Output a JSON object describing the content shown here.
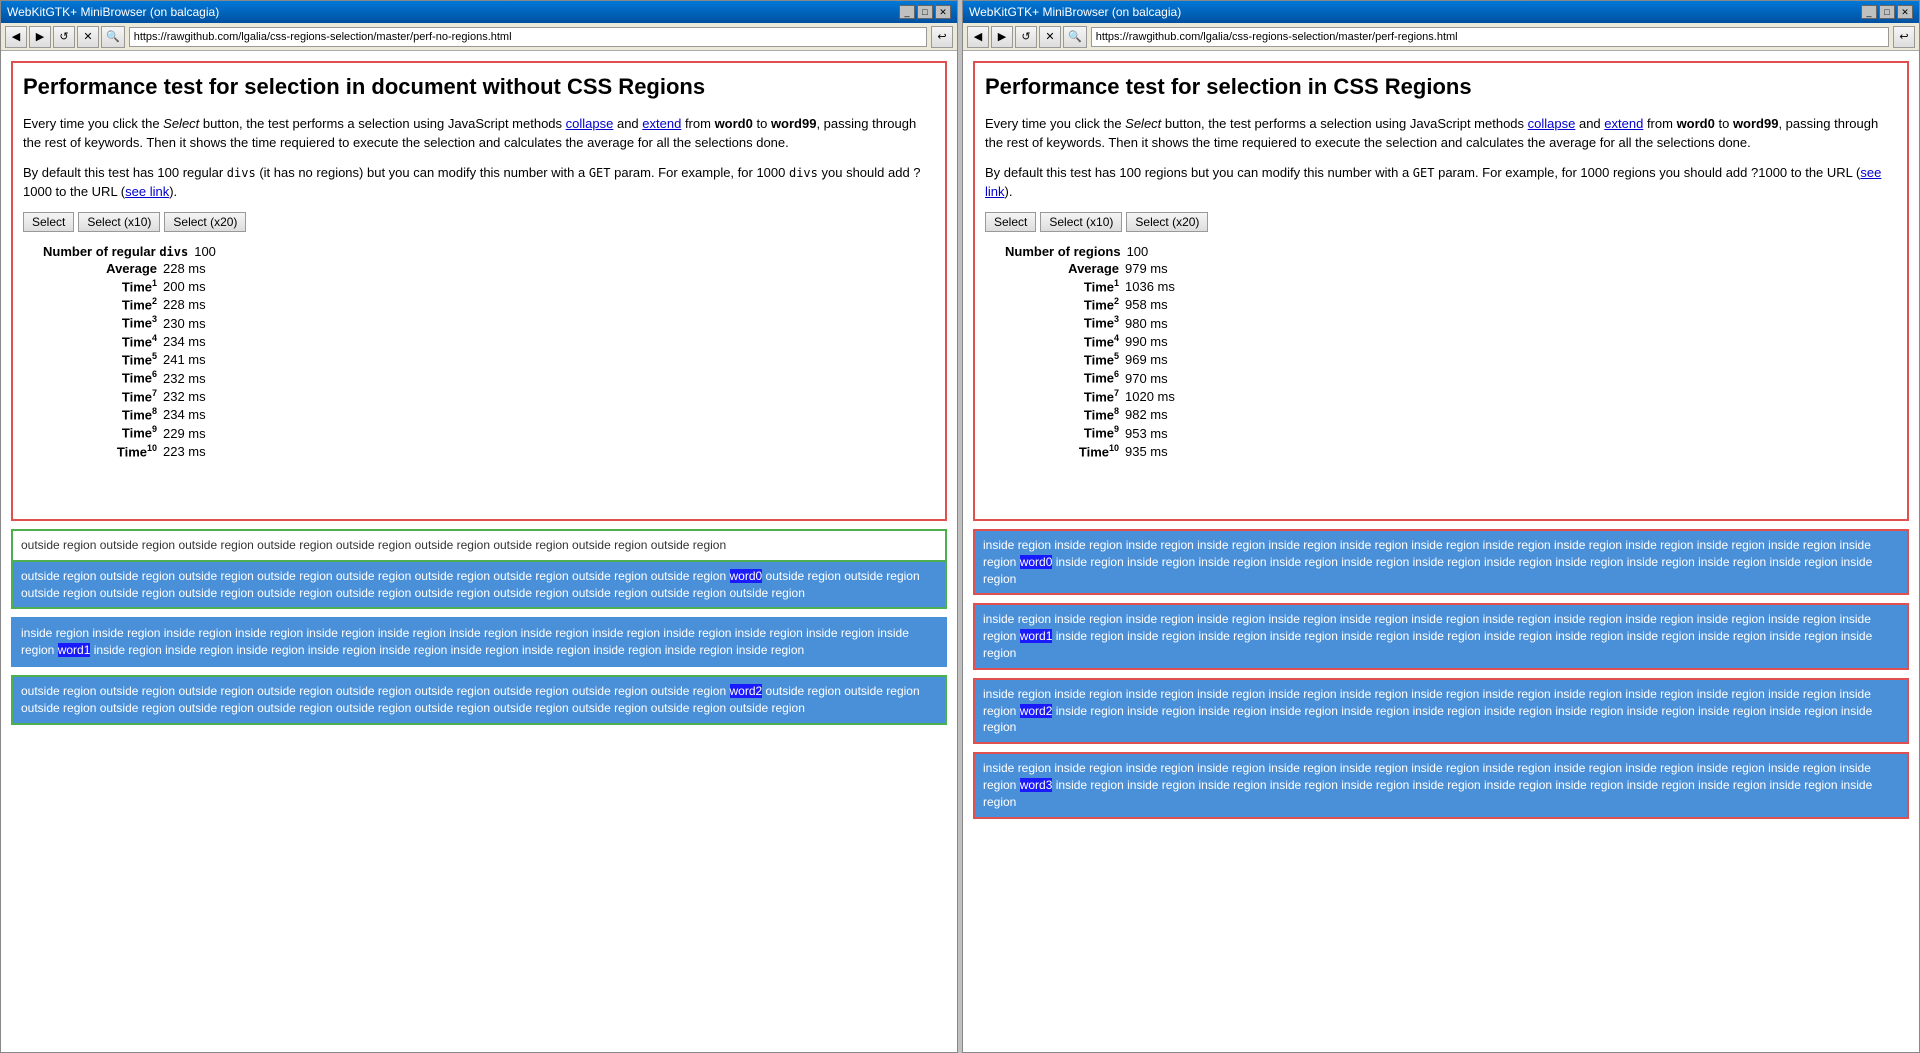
{
  "windows": [
    {
      "id": "window-left",
      "title": "WebKitGTK+ MiniBrowser (on balcagia)",
      "url": "https://rawgithub.com/lgalia/css-regions-selection/master/perf-no-regions.html",
      "page": {
        "title": "Performance test for selection in document without CSS Regions",
        "desc1_prefix": "Every time you click the ",
        "desc1_select_italic": "Select",
        "desc1_middle": " button, the test performs a selection using JavaScript methods ",
        "desc1_collapse_link": "collapse",
        "desc1_and": " and ",
        "desc1_extend_link": "extend",
        "desc1_from": " from ",
        "desc1_word0": "word0",
        "desc1_to": " to ",
        "desc1_word99": "word99",
        "desc1_end": ", passing through the rest of keywords. Then it shows the time requiered to execute the selection and calculates the average for all the selections done.",
        "desc2": "By default this test has 100 regular",
        "desc2_code": "divs",
        "desc2_mid": "(it has no regions) but you can modify this number with a",
        "desc2_get": "GET",
        "desc2_end": "param. For example, for 1000",
        "desc2_divs": "divs",
        "desc2_end2": "you should add ?1000 to the URL (",
        "desc2_see_link": "see link",
        "desc2_close": ").",
        "btn_select": "Select",
        "btn_select10": "Select (x10)",
        "btn_select20": "Select (x20)",
        "stats": {
          "number_label": "Number of regular",
          "number_code": "divs",
          "number_value": "100",
          "average_label": "Average",
          "average_value": "228 ms",
          "times": [
            {
              "n": "1",
              "value": "200 ms"
            },
            {
              "n": "2",
              "value": "228 ms"
            },
            {
              "n": "3",
              "value": "230 ms"
            },
            {
              "n": "4",
              "value": "234 ms"
            },
            {
              "n": "5",
              "value": "241 ms"
            },
            {
              "n": "6",
              "value": "232 ms"
            },
            {
              "n": "7",
              "value": "232 ms"
            },
            {
              "n": "8",
              "value": "234 ms"
            },
            {
              "n": "9",
              "value": "229 ms"
            },
            {
              "n": "10",
              "value": "223 ms"
            }
          ]
        },
        "regions": [
          {
            "type": "outside-mixed",
            "text_before": "outside region outside region outside region outside region outside region outside region outside region outside region outside region ",
            "word": "word0",
            "text_after": " outside region outside region outside region outside region outside region outside region outside region outside region outside region outside region outside region outside region"
          },
          {
            "type": "inside",
            "text_before": "inside region inside region inside region inside region inside region inside region inside region inside region inside region inside region inside region inside region inside region ",
            "word": "word1",
            "text_after": " inside region inside region inside region inside region inside region inside region inside region inside region inside region inside region"
          },
          {
            "type": "outside",
            "text_before": "outside region outside region outside region outside region outside region outside region outside region outside region outside region ",
            "word": "word2",
            "text_after": " outside region outside region outside region outside region outside region outside region outside region outside region outside region outside region outside region outside region"
          }
        ]
      }
    },
    {
      "id": "window-right",
      "title": "WebKitGTK+ MiniBrowser (on balcagia)",
      "url": "https://rawgithub.com/lgalia/css-regions-selection/master/perf-regions.html",
      "page": {
        "title": "Performance test for selection in CSS Regions",
        "desc1_prefix": "Every time you click the ",
        "desc1_select_italic": "Select",
        "desc1_middle": " button, the test performs a selection using JavaScript methods ",
        "desc1_collapse_link": "collapse",
        "desc1_and": " and ",
        "desc1_extend_link": "extend",
        "desc1_from": " from ",
        "desc1_word0": "word0",
        "desc1_to": " to ",
        "desc1_word99": "word99",
        "desc1_end": ", passing through the rest of keywords. Then it shows the time requiered to execute the selection and calculates the average for all the selections done.",
        "desc2": "By default this test has 100 regions but you can modify this number with a GET param. For example, for 1000 regions you should add ?1000 to the URL (",
        "desc2_see_link": "see link",
        "desc2_close": ").",
        "btn_select": "Select",
        "btn_select10": "Select (x10)",
        "btn_select20": "Select (x20)",
        "stats": {
          "number_label": "Number of regions",
          "number_value": "100",
          "average_label": "Average",
          "average_value": "979 ms",
          "times": [
            {
              "n": "1",
              "value": "1036 ms"
            },
            {
              "n": "2",
              "value": "958 ms"
            },
            {
              "n": "3",
              "value": "980 ms"
            },
            {
              "n": "4",
              "value": "990 ms"
            },
            {
              "n": "5",
              "value": "969 ms"
            },
            {
              "n": "6",
              "value": "970 ms"
            },
            {
              "n": "7",
              "value": "1020 ms"
            },
            {
              "n": "8",
              "value": "982 ms"
            },
            {
              "n": "9",
              "value": "953 ms"
            },
            {
              "n": "10",
              "value": "935 ms"
            }
          ]
        },
        "regions": [
          {
            "type": "inside-red",
            "text_before": "inside region inside region inside region inside region inside region inside region inside region inside region inside region inside region inside region inside region inside region ",
            "word": "word0",
            "text_after": " inside region inside region inside region inside region inside region inside region inside region inside region inside region inside region inside region inside region"
          },
          {
            "type": "inside-red",
            "text_before": "inside region inside region inside region inside region inside region inside region inside region inside region inside region inside region inside region inside region inside region ",
            "word": "word1",
            "text_after": " inside region inside region inside region inside region inside region inside region inside region inside region inside region inside region inside region inside region"
          },
          {
            "type": "inside-red",
            "text_before": "inside region inside region inside region inside region inside region inside region inside region inside region inside region inside region inside region inside region inside region ",
            "word": "word2",
            "text_after": " inside region inside region inside region inside region inside region inside region inside region inside region inside region inside region inside region inside region"
          },
          {
            "type": "inside-red",
            "text_before": "inside region inside region inside region inside region inside region inside region inside region inside region inside region inside region inside region inside region inside region ",
            "word": "word3",
            "text_after": " inside region inside region inside region inside region inside region inside region inside region inside region inside region inside region inside region inside region"
          }
        ]
      }
    }
  ]
}
